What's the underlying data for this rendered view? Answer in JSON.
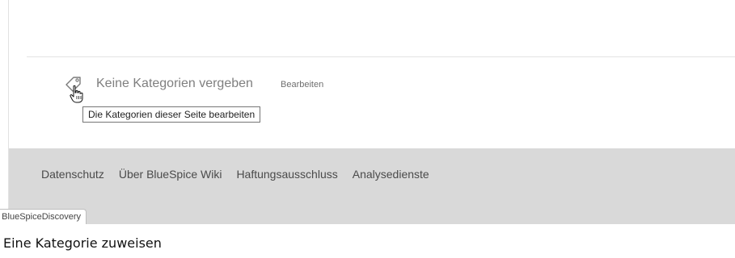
{
  "categories": {
    "none_label": "Keine Kategorien vergeben",
    "edit_label": "Bearbeiten",
    "tooltip": "Die Kategorien dieser Seite bearbeiten",
    "icon": "tag-icon"
  },
  "footer": {
    "links": [
      "Datenschutz",
      "Über BlueSpice Wiki",
      "Haftungsausschluss",
      "Analysedienste"
    ]
  },
  "skin_tab": {
    "label": "BlueSpiceDiscovery"
  },
  "caption": "Eine Kategorie zuweisen"
}
